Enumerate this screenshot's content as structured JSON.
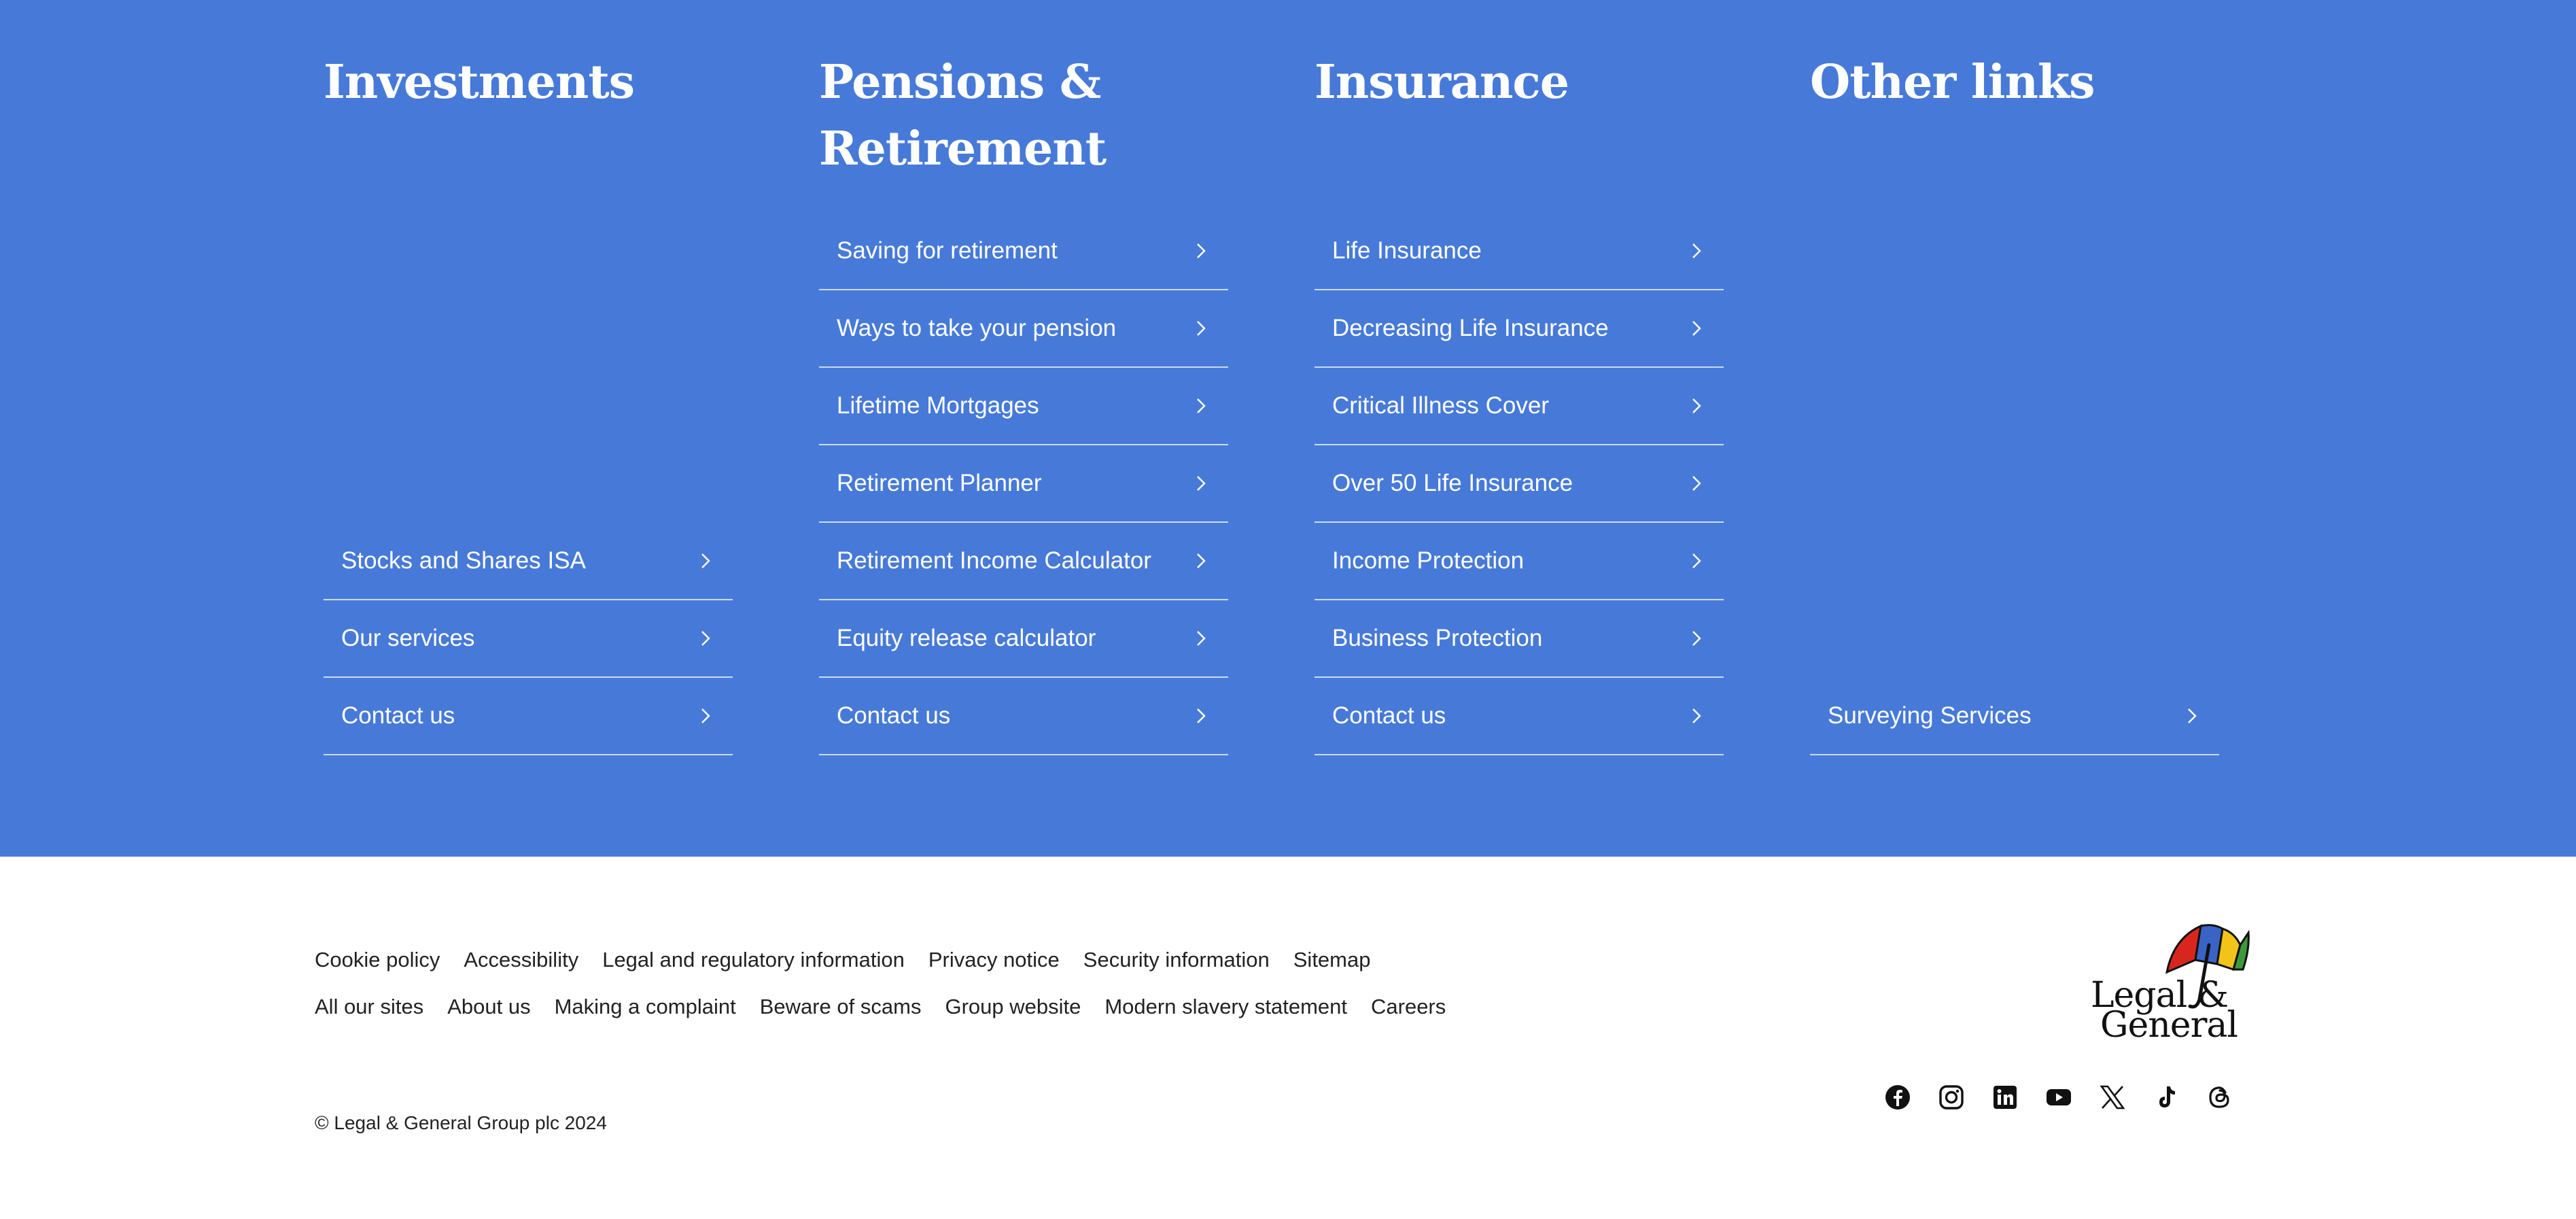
{
  "footer_columns": [
    {
      "title": "Investments",
      "links": [
        "Stocks and Shares ISA",
        "Our services",
        "Contact us"
      ]
    },
    {
      "title": "Pensions & Retirement",
      "links": [
        "Saving for retirement",
        "Ways to take your pension",
        "Lifetime Mortgages",
        "Retirement Planner",
        "Retirement Income Calculator",
        "Equity release calculator",
        "Contact us"
      ]
    },
    {
      "title": "Insurance",
      "links": [
        "Life Insurance",
        "Decreasing Life Insurance",
        "Critical Illness Cover",
        "Over 50 Life Insurance",
        "Income Protection",
        "Business Protection",
        "Contact us"
      ]
    },
    {
      "title": "Other links",
      "links": [
        "Surveying Services"
      ]
    }
  ],
  "legal_links": {
    "row1": [
      "Cookie policy",
      "Accessibility",
      "Legal and regulatory information",
      "Privacy notice",
      "Security information",
      "Sitemap"
    ],
    "row2": [
      "All our sites",
      "About us",
      "Making a complaint",
      "Beware of scams",
      "Group website",
      "Modern slavery statement",
      "Careers"
    ]
  },
  "copyright": "© Legal & General Group plc 2024",
  "logo": {
    "line1": "Legal &",
    "line2": "General",
    "colors": [
      "#d7261e",
      "#3a63c6",
      "#f2c318",
      "#3b9a3a"
    ]
  },
  "social_icons": [
    "facebook-icon",
    "instagram-icon",
    "linkedin-icon",
    "youtube-icon",
    "x-icon",
    "tiktok-icon",
    "threads-icon"
  ],
  "colors": {
    "band": "#477ad8",
    "text_on_band": "#ffffff",
    "footer_text": "#222222"
  }
}
